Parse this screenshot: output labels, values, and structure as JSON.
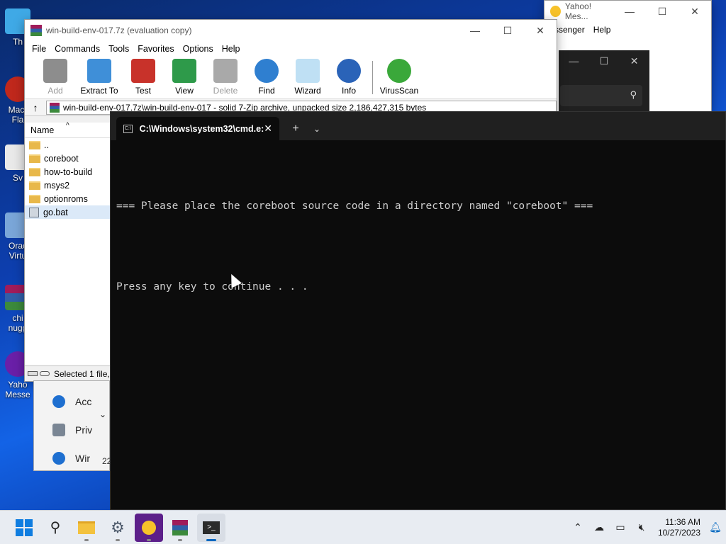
{
  "desktop": {
    "icons": [
      {
        "label": "Th"
      },
      {
        "label": "Macr\nFla"
      },
      {
        "label": "Sv"
      },
      {
        "label": "Orac\nVirtu"
      },
      {
        "label": "chi\nnugg"
      },
      {
        "label": "Yaho\nMesse"
      }
    ]
  },
  "winrar": {
    "title": "win-build-env-017.7z (evaluation copy)",
    "menu": [
      "File",
      "Commands",
      "Tools",
      "Favorites",
      "Options",
      "Help"
    ],
    "toolbar": [
      "Add",
      "Extract To",
      "Test",
      "View",
      "Delete",
      "Find",
      "Wizard",
      "Info",
      "VirusScan"
    ],
    "path": "win-build-env-017.7z\\win-build-env-017 - solid 7-Zip archive, unpacked size 2,186,427,315 bytes",
    "column_name": "Name",
    "files": [
      "..",
      "coreboot",
      "how-to-build",
      "msys2",
      "optionroms",
      "go.bat"
    ],
    "status": "Selected 1 file,"
  },
  "yahoo": {
    "title": "Yahoo! Mes...",
    "menu": [
      "ssenger",
      "Help"
    ]
  },
  "settings": {
    "items": [
      "Acc",
      "Priv",
      "Wir"
    ],
    "number": "22"
  },
  "terminal": {
    "tab_title": "C:\\Windows\\system32\\cmd.e:",
    "line1": "=== Please place the coreboot source code in a directory named \"coreboot\" ===",
    "line2": "Press any key to continue . . ."
  },
  "taskbar": {
    "time": "11:36 AM",
    "date": "10/27/2023"
  },
  "colors": {
    "accent": "#0067c0",
    "terminal_bg": "#0c0c0c",
    "terminal_text": "#cccccc"
  }
}
